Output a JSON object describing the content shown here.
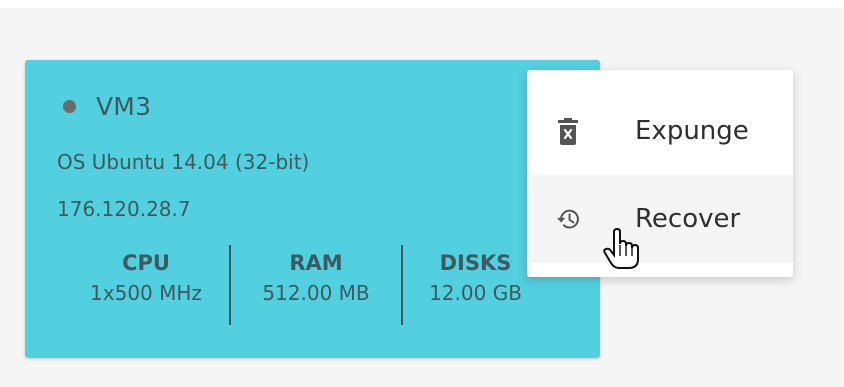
{
  "vm": {
    "name": "VM3",
    "os": "OS Ubuntu 14.04 (32-bit)",
    "ip": "176.120.28.7",
    "status_color": "#6b6b6b",
    "card_color": "#53d0e0",
    "stats": {
      "cpu_label": "CPU",
      "cpu_value": "1x500 MHz",
      "ram_label": "RAM",
      "ram_value": "512.00 MB",
      "disks_label": "DISKS",
      "disks_value": "12.00 GB"
    }
  },
  "menu": {
    "items": [
      {
        "label": "Expunge",
        "icon": "trash-icon"
      },
      {
        "label": "Recover",
        "icon": "history-icon"
      }
    ]
  },
  "cursor": {
    "icon": "hand-pointer-icon"
  }
}
